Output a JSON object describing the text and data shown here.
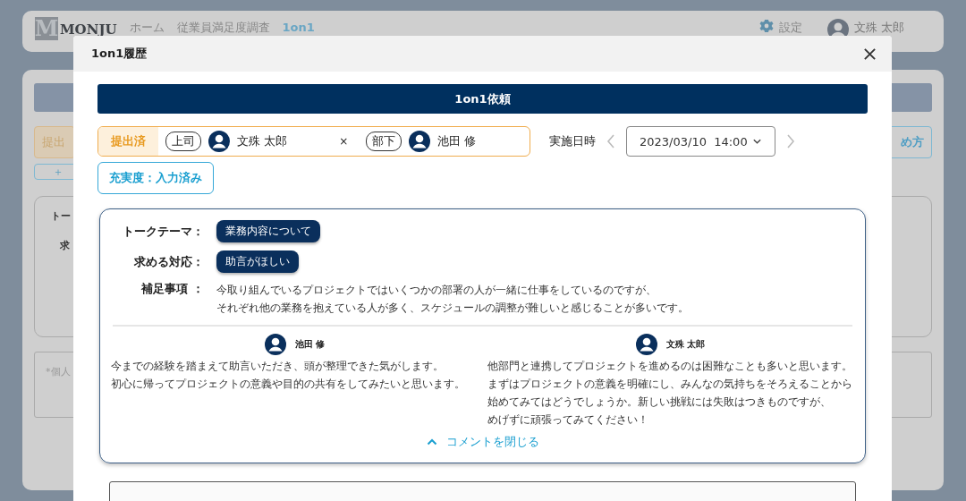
{
  "background": {
    "logo_mark": "M",
    "logo_text": "MONJU",
    "nav": [
      {
        "label": "ホーム",
        "selected": false
      },
      {
        "label": "従業員満足度調査",
        "selected": false
      },
      {
        "label": "1on1",
        "selected": true
      }
    ],
    "settings": "設定",
    "user": "文殊 太郎",
    "status_fragment": "提出",
    "right_button_fragment": "め方",
    "add_fragment": "＋",
    "theme_fragment": "トー",
    "response_fragment": "求",
    "note_fragment": "*個人"
  },
  "modal": {
    "title": "1on1履歴",
    "heading": "1on1依頼",
    "status": "提出済",
    "boss_label": "上司",
    "boss": "文殊 太郎",
    "separator": "×",
    "subordinate_label": "部下",
    "subordinate": "池田 修",
    "date_label": "実施日時",
    "date": "2023/03/10  14:00",
    "satisfaction": "充実度：入力済み",
    "theme": {
      "label": "トークテーマ：",
      "tag": "業務内容について"
    },
    "response": {
      "label": "求める対応：",
      "tag": "助言がほしい"
    },
    "notes": {
      "label": "補足事項 ：",
      "lines": [
        "今取り組んでいるプロジェクトではいくつかの部署の人が一緒に仕事をしているのですが、",
        "それぞれ他の業務を抱えている人が多く、スケジュールの調整が難しいと感じることが多いです。"
      ]
    },
    "comments": [
      {
        "name": "池田 修",
        "lines": [
          "今までの経験を踏まえて助言いただき、頭が整理できた気がします。",
          "初心に帰ってプロジェクトの意義や目的の共有をしてみたいと思います。"
        ]
      },
      {
        "name": "文殊 太郎",
        "lines": [
          "他部門と連携してプロジェクトを進めるのは困難なことも多いと思います。",
          "まずはプロジェクトの意義を明確にし、みんなの気持ちをそろえることから",
          "始めてみてはどうでしょうか。新しい挑戦には失敗はつきものですが、",
          "めげずに頑張ってみてください！"
        ]
      }
    ],
    "toggle": "コメントを閉じる"
  }
}
